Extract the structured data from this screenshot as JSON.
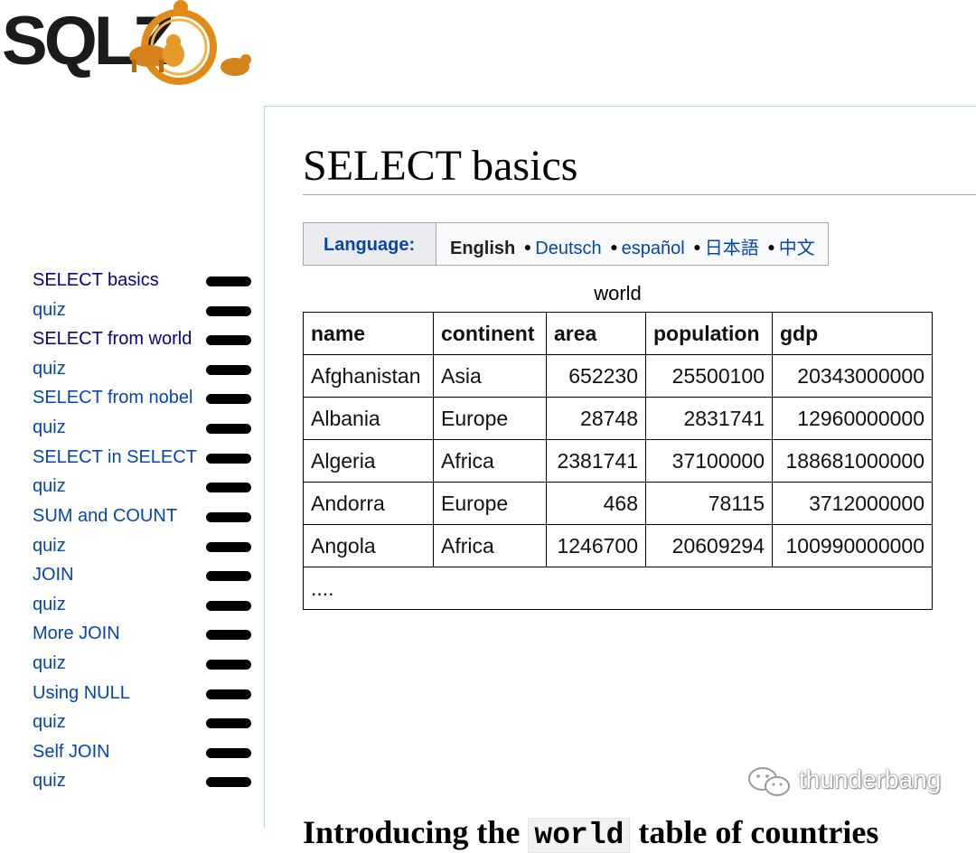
{
  "logo": {
    "text": "SQLZ"
  },
  "sidebar": {
    "items": [
      {
        "label": "SELECT basics",
        "visited": true
      },
      {
        "label": "quiz",
        "visited": false
      },
      {
        "label": "SELECT from world",
        "visited": true
      },
      {
        "label": "quiz",
        "visited": false
      },
      {
        "label": "SELECT from nobel",
        "visited": false
      },
      {
        "label": "quiz",
        "visited": false
      },
      {
        "label": "SELECT in SELECT",
        "visited": false
      },
      {
        "label": "quiz",
        "visited": false
      },
      {
        "label": "SUM and COUNT",
        "visited": false
      },
      {
        "label": "quiz",
        "visited": false
      },
      {
        "label": "JOIN",
        "visited": false
      },
      {
        "label": "quiz",
        "visited": false
      },
      {
        "label": "More JOIN",
        "visited": false
      },
      {
        "label": "quiz",
        "visited": false
      },
      {
        "label": "Using NULL",
        "visited": false
      },
      {
        "label": "quiz",
        "visited": false
      },
      {
        "label": "Self JOIN",
        "visited": false
      },
      {
        "label": "quiz",
        "visited": false
      }
    ]
  },
  "main": {
    "title": "SELECT basics",
    "language": {
      "label": "Language:",
      "current": "English",
      "others": [
        "Deutsch",
        "español",
        "日本語",
        "中文"
      ]
    },
    "table": {
      "caption": "world",
      "columns": [
        "name",
        "continent",
        "area",
        "population",
        "gdp"
      ],
      "rows": [
        [
          "Afghanistan",
          "Asia",
          "652230",
          "25500100",
          "20343000000"
        ],
        [
          "Albania",
          "Europe",
          "28748",
          "2831741",
          "12960000000"
        ],
        [
          "Algeria",
          "Africa",
          "2381741",
          "37100000",
          "188681000000"
        ],
        [
          "Andorra",
          "Europe",
          "468",
          "78115",
          "3712000000"
        ],
        [
          "Angola",
          "Africa",
          "1246700",
          "20609294",
          "100990000000"
        ]
      ],
      "more": "...."
    },
    "intro": {
      "before": "Introducing the ",
      "code": "world",
      "after": " table of countries"
    }
  },
  "watermark": {
    "text": "thunderbang"
  },
  "colors": {
    "link": "#0645ad",
    "visited": "#0b0080",
    "panel_border": "#a7d7f9"
  }
}
